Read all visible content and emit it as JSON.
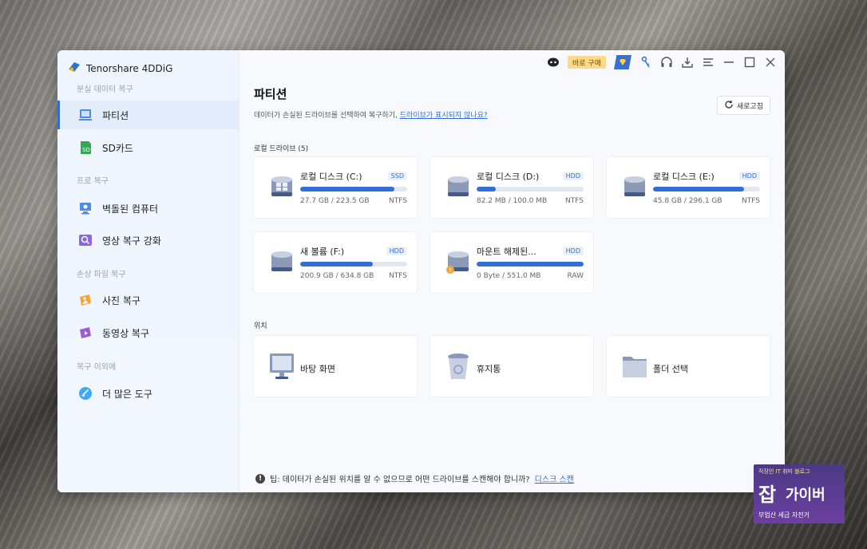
{
  "app": {
    "title": "Tenorshare 4DDiG",
    "accent": "#2f6fd6"
  },
  "sidebar": {
    "sections": [
      "분실 데이터 복구",
      "프로 복구",
      "손상 파일 복구",
      "복구 이외에"
    ],
    "items": [
      {
        "label": "파티션",
        "icon": "partition-icon",
        "active": true
      },
      {
        "label": "SD카드",
        "icon": "sd-card-icon"
      },
      {
        "label": "벽돌된 컴퓨터",
        "icon": "computer-icon"
      },
      {
        "label": "영상 복구 강화",
        "icon": "video-repair-icon"
      },
      {
        "label": "사진 복구",
        "icon": "photo-icon"
      },
      {
        "label": "동영상 복구",
        "icon": "video-icon"
      },
      {
        "label": "더 많은 도구",
        "icon": "tools-icon"
      }
    ]
  },
  "topbar": {
    "buy_label": "바로 구매"
  },
  "main": {
    "title": "파티션",
    "subtitle": "데이터가 손실된 드라이브를 선택하여 복구하기, ",
    "subtitle_link": "드라이브가 표시되지 않나요?",
    "refresh_label": "새로고침",
    "local_drives_label": "로컬 드라이브 (5)",
    "drives": [
      {
        "name": "로컬 디스크 (C:)",
        "type": "SSD",
        "size": "27.7 GB / 223.5 GB",
        "fs": "NTFS",
        "used": 0.88,
        "os": true
      },
      {
        "name": "로컬 디스크 (D:)",
        "type": "HDD",
        "size": "82.2 MB / 100.0 MB",
        "fs": "NTFS",
        "used": 0.18
      },
      {
        "name": "로컬 디스크 (E:)",
        "type": "HDD",
        "size": "45.8 GB / 296.1 GB",
        "fs": "NTFS",
        "used": 0.85
      },
      {
        "name": "새 볼륨 (F:)",
        "type": "HDD",
        "size": "200.9 GB / 634.8 GB",
        "fs": "NTFS",
        "used": 0.68
      },
      {
        "name": "마운트 해제된...",
        "type": "HDD",
        "size": "0 Byte / 551.0 MB",
        "fs": "RAW",
        "used": 1.0,
        "warning": true
      }
    ],
    "location_label": "위치",
    "locations": [
      {
        "name": "바탕 화면",
        "icon": "desktop-icon"
      },
      {
        "name": "휴지통",
        "icon": "recycle-bin-icon"
      },
      {
        "name": "폴더 선택",
        "icon": "folder-icon"
      }
    ],
    "tip_text": "팁: 데이터가 손실된 위치를 알 수 없으므로 어떤 드라이브를 스캔해야 합니까?",
    "tip_link": "디스크 스캔"
  },
  "watermark": {
    "top": "직장인 IT 취미 블로그",
    "big": "잡",
    "big2": "가이버",
    "bottom": "부업산 세금 자전거"
  }
}
